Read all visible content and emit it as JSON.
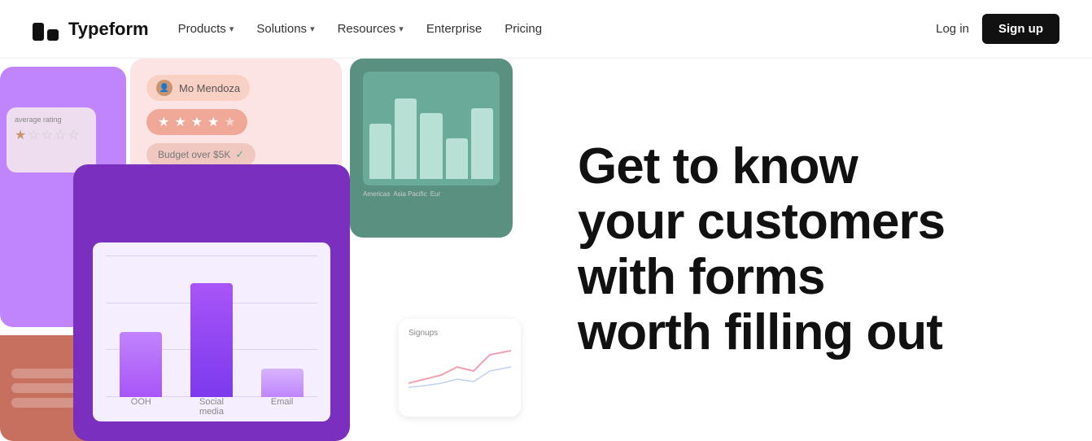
{
  "brand": {
    "name": "Typeform"
  },
  "nav": {
    "links": [
      {
        "label": "Products",
        "hasDropdown": true
      },
      {
        "label": "Solutions",
        "hasDropdown": true
      },
      {
        "label": "Resources",
        "hasDropdown": true
      },
      {
        "label": "Enterprise",
        "hasDropdown": false
      },
      {
        "label": "Pricing",
        "hasDropdown": false
      }
    ],
    "login_label": "Log in",
    "signup_label": "Sign up"
  },
  "hero": {
    "heading_line1": "Get to know",
    "heading_line2": "your customers",
    "heading_line3": "with forms",
    "heading_line4": "worth filling out"
  },
  "chart": {
    "bars": [
      {
        "label": "OOH"
      },
      {
        "label": "Social media"
      },
      {
        "label": "Email"
      }
    ]
  },
  "rating_card": {
    "user_name": "Mo Mendoza",
    "budget_label": "Budget over $5K",
    "avg_label": "average rating"
  },
  "green_card": {
    "labels": [
      "Americas",
      "Asia Pacific",
      "Eur"
    ]
  },
  "signups_card": {
    "label": "Signups"
  }
}
